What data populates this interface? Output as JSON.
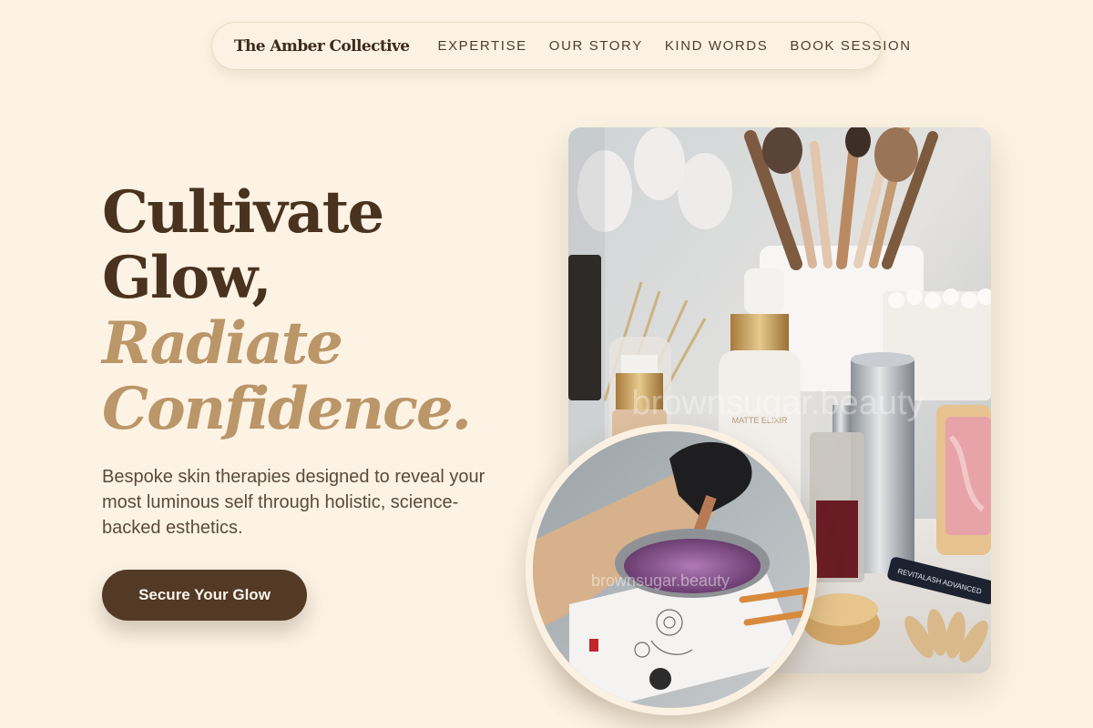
{
  "nav": {
    "brand": "The Amber Collective",
    "links": [
      "EXPERTISE",
      "OUR STORY",
      "KIND WORDS",
      "BOOK SESSION"
    ]
  },
  "hero": {
    "headline_line1": "Cultivate",
    "headline_line2": "Glow,",
    "headline_line3": "Radiate",
    "headline_line4": "Confidence.",
    "subtext": "Bespoke skin therapies designed to reveal your most luminous self through holistic, science-backed esthetics.",
    "cta_label": "Secure Your Glow"
  },
  "images": {
    "main_watermark": "brownsugar.beauty",
    "circle_watermark": "brownsugar.beauty",
    "bottle_label": "MATTE ELIXIR",
    "mascara_label": "REVITALASH ADVANCED"
  },
  "colors": {
    "background": "#fcf3e4",
    "heading_dark": "#49331f",
    "heading_gold": "#bb9669",
    "button": "#523a26"
  }
}
